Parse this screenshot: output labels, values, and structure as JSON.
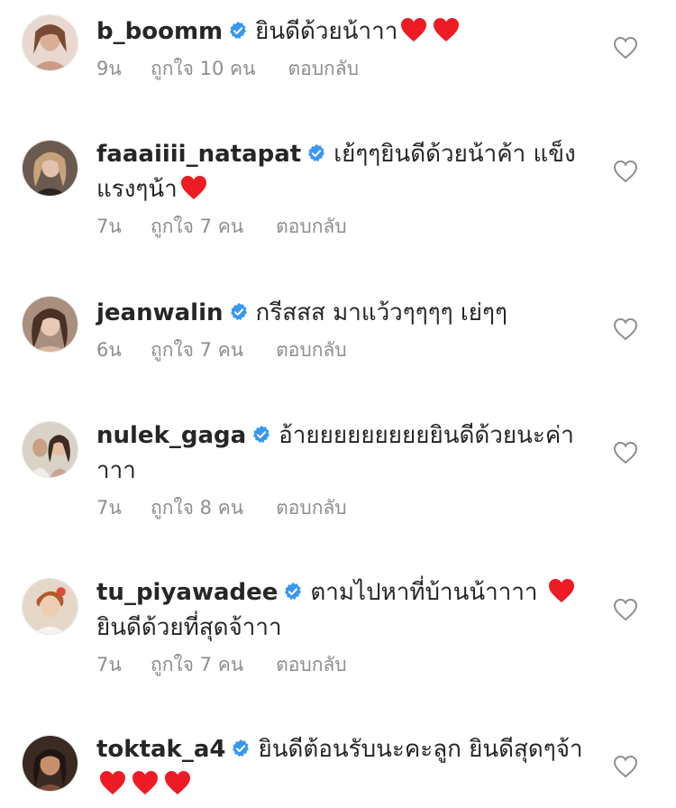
{
  "accent": {
    "verified_blue": "#3897f0",
    "heart_red": "#ed1c24",
    "meta_grey": "#8e8e8e",
    "text_dark": "#262626"
  },
  "icons": {
    "verified": "verified-badge-icon",
    "like": "heart-outline-icon",
    "emoji": "red-heart-emoji"
  },
  "comments": [
    {
      "username": "b_boomm",
      "verified": true,
      "text_before": "ยินดีด้วยน้าาา",
      "hearts_inline": 2,
      "text_after": "",
      "time": "9น",
      "likes": "ถูกใจ 10 คน",
      "reply": "ตอบกลับ"
    },
    {
      "username": "faaaiiii_natapat",
      "verified": true,
      "text_before": "เย้ๆๆยินดีด้วยน้าค้า แข็งแรงๆน้า",
      "hearts_inline": 1,
      "text_after": "",
      "time": "7น",
      "likes": "ถูกใจ 7 คน",
      "reply": "ตอบกลับ"
    },
    {
      "username": "jeanwalin",
      "verified": true,
      "text_before": "กรีสสส มาแว้วๆๆๆๆ เย่ๆๆ",
      "hearts_inline": 0,
      "text_after": "",
      "time": "6น",
      "likes": "ถูกใจ 7 คน",
      "reply": "ตอบกลับ"
    },
    {
      "username": "nulek_gaga",
      "verified": true,
      "text_before": "อ้ายยยยยยยยยยินดีด้วยนะค่าาาา",
      "hearts_inline": 0,
      "text_after": "",
      "time": "7น",
      "likes": "ถูกใจ 8 คน",
      "reply": "ตอบกลับ"
    },
    {
      "username": "tu_piyawadee",
      "verified": true,
      "text_before": "ตามไปหาที่บ้านน้าาาา",
      "hearts_inline": 1,
      "text_after": "ยินดีด้วยที่สุดจ้าาา",
      "time": "7น",
      "likes": "ถูกใจ 7 คน",
      "reply": "ตอบกลับ"
    },
    {
      "username": "toktak_a4",
      "verified": true,
      "text_before": "ยินดีต้อนรับนะคะลูก ยินดีสุดๆจ้า",
      "hearts_inline": 3,
      "text_after": "",
      "time": "",
      "likes": "",
      "reply": ""
    }
  ]
}
